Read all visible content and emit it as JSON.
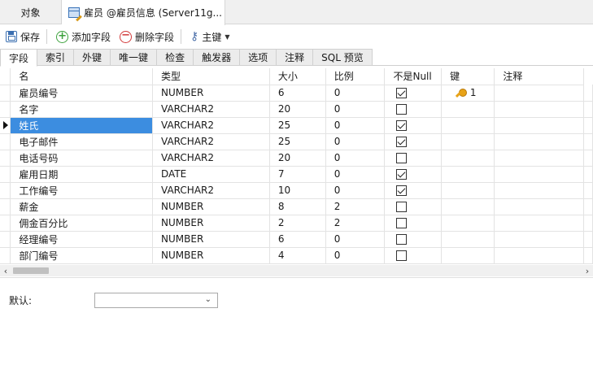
{
  "doc_tabs": [
    {
      "label": "对象"
    },
    {
      "label": "雇员 @雇员信息 (Server11g..."
    }
  ],
  "toolbar": {
    "save_label": "保存",
    "add_field_label": "添加字段",
    "delete_field_label": "删除字段",
    "primary_key_label": "主键"
  },
  "sub_tabs": [
    "字段",
    "索引",
    "外键",
    "唯一键",
    "检查",
    "触发器",
    "选项",
    "注释",
    "SQL 预览"
  ],
  "table": {
    "headers": [
      "名",
      "类型",
      "大小",
      "比例",
      "不是Null",
      "键",
      "注释"
    ],
    "rows": [
      {
        "name": "雇员编号",
        "type": "NUMBER",
        "size": "6",
        "scale": "0",
        "not_null": true,
        "key": "1"
      },
      {
        "name": "名字",
        "type": "VARCHAR2",
        "size": "20",
        "scale": "0",
        "not_null": false,
        "key": ""
      },
      {
        "name": "姓氏",
        "type": "VARCHAR2",
        "size": "25",
        "scale": "0",
        "not_null": true,
        "key": ""
      },
      {
        "name": "电子邮件",
        "type": "VARCHAR2",
        "size": "25",
        "scale": "0",
        "not_null": true,
        "key": ""
      },
      {
        "name": "电话号码",
        "type": "VARCHAR2",
        "size": "20",
        "scale": "0",
        "not_null": false,
        "key": ""
      },
      {
        "name": "雇用日期",
        "type": "DATE",
        "size": "7",
        "scale": "0",
        "not_null": true,
        "key": ""
      },
      {
        "name": "工作编号",
        "type": "VARCHAR2",
        "size": "10",
        "scale": "0",
        "not_null": true,
        "key": ""
      },
      {
        "name": "薪金",
        "type": "NUMBER",
        "size": "8",
        "scale": "2",
        "not_null": false,
        "key": ""
      },
      {
        "name": "佣金百分比",
        "type": "NUMBER",
        "size": "2",
        "scale": "2",
        "not_null": false,
        "key": ""
      },
      {
        "name": "经理编号",
        "type": "NUMBER",
        "size": "6",
        "scale": "0",
        "not_null": false,
        "key": ""
      },
      {
        "name": "部门编号",
        "type": "NUMBER",
        "size": "4",
        "scale": "0",
        "not_null": false,
        "key": ""
      }
    ]
  },
  "default_field": {
    "label": "默认:",
    "value": ""
  }
}
